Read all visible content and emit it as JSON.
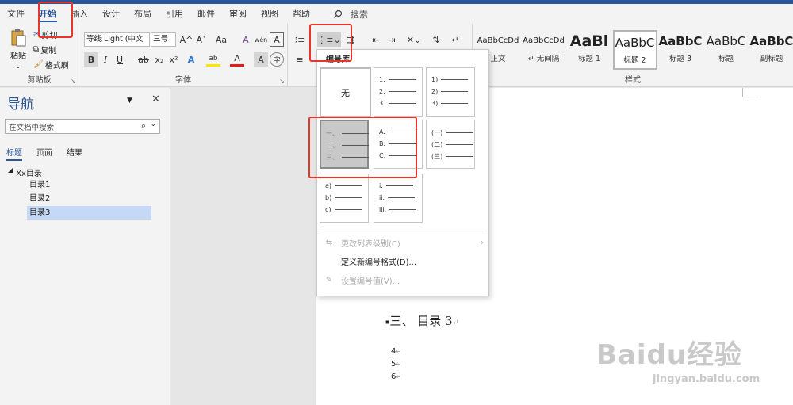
{
  "tabs": [
    "文件",
    "开始",
    "插入",
    "设计",
    "布局",
    "引用",
    "邮件",
    "审阅",
    "视图",
    "帮助"
  ],
  "search_label": "搜索",
  "clipboard": {
    "paste": "粘贴",
    "cut": "剪切",
    "copy": "复制",
    "format_painter": "格式刷",
    "group": "剪贴板"
  },
  "font": {
    "name": "等线 Light (中文",
    "size": "三号",
    "group": "字体",
    "bold": "B",
    "italic": "I",
    "underline": "U",
    "strike": "ab",
    "sub": "x₂",
    "sup": "x²",
    "grow": "A^",
    "shrink": "Aˇ",
    "case": "Aa",
    "clear": "A",
    "phonetic": "wén",
    "border_char": "A",
    "effects": "A",
    "highlight": "ab",
    "font_color": "A",
    "enclose": "A",
    "circle": "字"
  },
  "styles": {
    "group": "样式",
    "items": [
      {
        "preview": "AaBbCcDd",
        "name": "正文"
      },
      {
        "preview": "AaBbCcDd",
        "name": "↵ 无间隔"
      },
      {
        "preview": "AaBl",
        "name": "标题 1"
      },
      {
        "preview": "AaBbC",
        "name": "标题 2"
      },
      {
        "preview": "AaBbC",
        "name": "标题 3"
      },
      {
        "preview": "AaBbC",
        "name": "标题"
      },
      {
        "preview": "AaBbC",
        "name": "副标题"
      }
    ]
  },
  "numbering": {
    "library_title": "编号库",
    "none_label": "无",
    "options": [
      {
        "id": "arabic_dot",
        "lines": [
          "1.",
          "2.",
          "3."
        ]
      },
      {
        "id": "arabic_paren",
        "lines": [
          "1)",
          "2)",
          "3)"
        ]
      },
      {
        "id": "chinese_comma",
        "lines": [
          "一、",
          "二、",
          "三、"
        ]
      },
      {
        "id": "upper_alpha",
        "lines": [
          "A.",
          "B.",
          "C."
        ]
      },
      {
        "id": "chinese_paren",
        "lines": [
          "(一)",
          "(二)",
          "(三)"
        ]
      },
      {
        "id": "lower_alpha",
        "lines": [
          "a)",
          "b)",
          "c)"
        ]
      },
      {
        "id": "roman",
        "lines": [
          "i.",
          "ii.",
          "iii."
        ]
      }
    ],
    "menu": [
      {
        "label": "更改列表级别(C)",
        "disabled": true
      },
      {
        "label": "定义新编号格式(D)...",
        "disabled": false
      },
      {
        "label": "设置编号值(V)...",
        "disabled": true
      }
    ]
  },
  "nav": {
    "title": "导航",
    "search_placeholder": "在文档中搜索",
    "tabs": [
      "标题",
      "页面",
      "结果"
    ],
    "tree": [
      {
        "label": "Xx目录",
        "level": 0
      },
      {
        "label": "目录1",
        "level": 1
      },
      {
        "label": "目录2",
        "level": 1
      },
      {
        "label": "目录3",
        "level": 1,
        "selected": true
      }
    ]
  },
  "document": {
    "heading": "三、 目录 3",
    "lines": [
      "4",
      "5",
      "6"
    ]
  },
  "watermark": {
    "logo": "Baidu经验",
    "url": "jingyan.baidu.com"
  },
  "colors": {
    "accent": "#2b579a",
    "highlight_box": "#e8352b",
    "selected_nav": "#c5d9f7"
  }
}
